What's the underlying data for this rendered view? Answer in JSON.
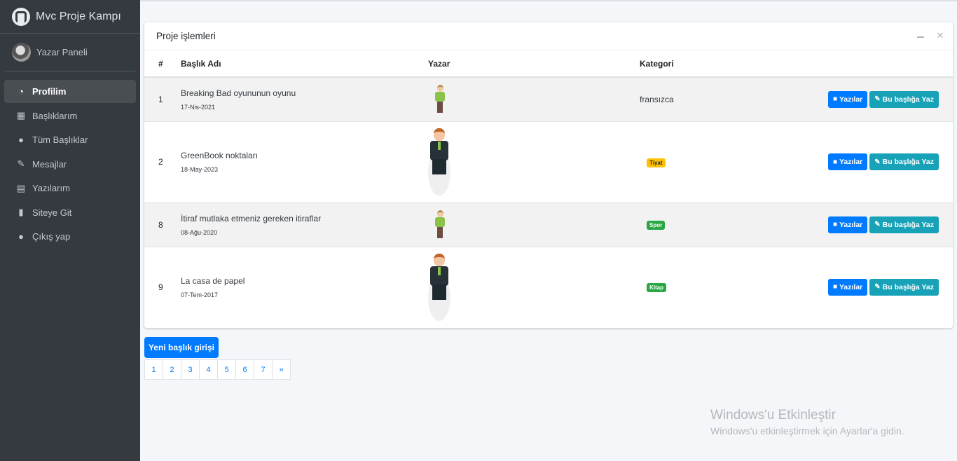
{
  "sidebar": {
    "brand": "Mvc Proje Kampı",
    "user": "Yazar Paneli",
    "items": [
      {
        "label": "Profilim",
        "icon": "gauge-icon",
        "glyph": "◔"
      },
      {
        "label": "Başlıklarım",
        "icon": "grid-icon",
        "glyph": "▦"
      },
      {
        "label": "Tüm Başlıklar",
        "icon": "apple-icon",
        "glyph": "●"
      },
      {
        "label": "Mesajlar",
        "icon": "edit-icon",
        "glyph": "✎"
      },
      {
        "label": "Yazılarım",
        "icon": "calendar-icon",
        "glyph": "▤"
      },
      {
        "label": "Siteye Git",
        "icon": "book-icon",
        "glyph": "▮"
      },
      {
        "label": "Çıkış yap",
        "icon": "apple-icon",
        "glyph": "●"
      }
    ]
  },
  "card": {
    "title": "Proje işlemleri",
    "headers": [
      "#",
      "Başlık Adı",
      "Yazar",
      "Kategori"
    ],
    "rows": [
      {
        "id": "1",
        "title": "Breaking Bad oyununun oyunu",
        "date": "17-Nis-2021",
        "category": "fransızca",
        "category_style": "text"
      },
      {
        "id": "2",
        "title": "GreenBook noktaları",
        "date": "18-May-2023",
        "category": "Tiyat",
        "category_style": "badge-yellow"
      },
      {
        "id": "8",
        "title": "İtiraf mutlaka etmeniz gereken itiraflar",
        "date": "08-Ağu-2020",
        "category": "Spor",
        "category_style": "badge-green"
      },
      {
        "id": "9",
        "title": "La casa de papel",
        "date": "07-Tem-2017",
        "category": "Kitap",
        "category_style": "badge-green"
      }
    ],
    "btn_posts": "Yazılar",
    "btn_write": "Bu başlığa Yaz"
  },
  "new_button": "Yeni başlık girişi",
  "pagination": [
    "1",
    "2",
    "3",
    "4",
    "5",
    "6",
    "7",
    "»"
  ],
  "watermark": {
    "title": "Windows'u Etkinleştir",
    "subtitle": "Windows'u etkinleştirmek için Ayarlar'a gidin."
  },
  "colors": {
    "primary": "#007bff",
    "info": "#17a2b8",
    "sidebar": "#343a40"
  }
}
